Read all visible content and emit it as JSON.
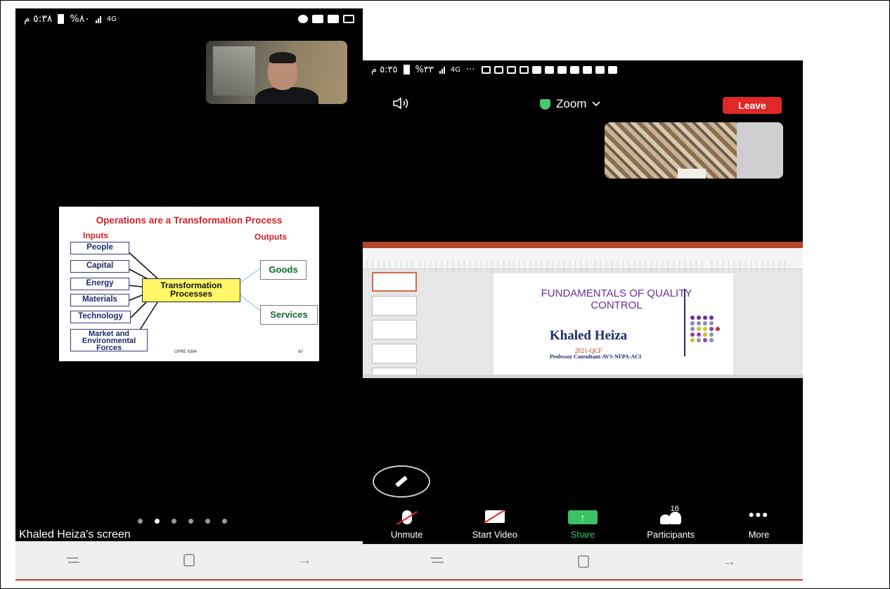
{
  "left_phone": {
    "status": {
      "time": "٥:٣٨ م",
      "battery": "%٨٠",
      "network": "4G"
    },
    "slide": {
      "title": "Operations are a Transformation Process",
      "inputs_header": "Inputs",
      "outputs_header": "Outputs",
      "inputs": [
        "People",
        "Capital",
        "Energy",
        "Materials",
        "Technology",
        "Market and Environmental Forces"
      ],
      "process": "Transformation Processes",
      "outputs": [
        "Goods",
        "Services"
      ],
      "footer_code": "OPRE 6364",
      "page_number": "60"
    },
    "page_dots": 6,
    "active_dot": 1,
    "screen_label": "Khaled Heiza's screen",
    "nav": {
      "back": "⤷",
      "home": "",
      "recent": "→"
    }
  },
  "right_phone": {
    "status": {
      "time": "٥:٣٥ م",
      "battery": "%٣٣",
      "network": "4G",
      "more": "···"
    },
    "meeting": {
      "title": "Zoom",
      "leave_label": "Leave",
      "speaker_icon": "speaker-icon",
      "secure_color": "#49c86b"
    },
    "slide": {
      "title": "FUNDAMENTALS OF QUALITY CONTROL",
      "presenter": "Khaled Heiza",
      "year": "2021-QCF",
      "subtitle": "Professor Consultant-AVS-NFPA-ACI"
    },
    "toolbar": {
      "unmute": "Unmute",
      "start_video": "Start Video",
      "share": "Share",
      "participants": "Participants",
      "participants_count": "16",
      "more": "More"
    },
    "colors": {
      "leave": "#e02828",
      "share": "#3ac265",
      "ppt_accent": "#b7472a"
    }
  }
}
